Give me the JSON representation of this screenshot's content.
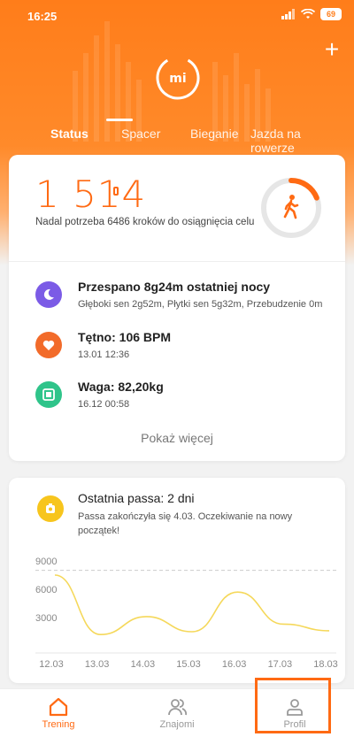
{
  "status_bar": {
    "time": "16:25",
    "battery": "69"
  },
  "header": {
    "logo_text": "mi",
    "tabs": [
      {
        "label": "Status",
        "active": true
      },
      {
        "label": "Spacer",
        "active": false
      },
      {
        "label": "Bieganie",
        "active": false
      },
      {
        "label": "Jazda na rowerze",
        "active": false
      }
    ]
  },
  "activity": {
    "steps": "1 514",
    "goal_caption": "Nadal potrzeba 6486 kroków do osiągnięcia celu",
    "goal_progress": 0.19
  },
  "metrics": [
    {
      "name": "sleep",
      "title": "Przespano 8g24m ostatniej nocy",
      "subtitle": "Głęboki sen 2g52m, Płytki sen 5g32m, Przebudzenie 0m",
      "color": "#7b5be6"
    },
    {
      "name": "heart",
      "title": "Tętno: 106 BPM",
      "subtitle": "13.01 12:36",
      "color": "#f26b2a"
    },
    {
      "name": "weight",
      "title": "Waga: 82,20kg",
      "subtitle": "16.12 00:58",
      "color": "#2fc48a"
    }
  ],
  "show_more_label": "Pokaż więcej",
  "streak": {
    "title": "Ostatnia passa: 2 dni",
    "description": "Passa zakończyła się 4.03. Oczekiwanie na nowy początek!"
  },
  "chart_data": {
    "type": "line",
    "x": [
      "12.03",
      "13.03",
      "14.03",
      "15.03",
      "16.03",
      "17.03",
      "18.03"
    ],
    "series": [
      {
        "values": [
          7500,
          1200,
          3100,
          1500,
          5700,
          2300,
          1600
        ]
      }
    ],
    "y_ticks": [
      "9000",
      "6000",
      "3000"
    ],
    "goal_line": 8000,
    "goal_label": "9000",
    "ylim": [
      0,
      9000
    ],
    "line_color": "#f5d85a"
  },
  "bottom_nav": [
    {
      "label": "Trening",
      "active": true
    },
    {
      "label": "Znajomi",
      "active": false
    },
    {
      "label": "Profil",
      "active": false
    }
  ]
}
